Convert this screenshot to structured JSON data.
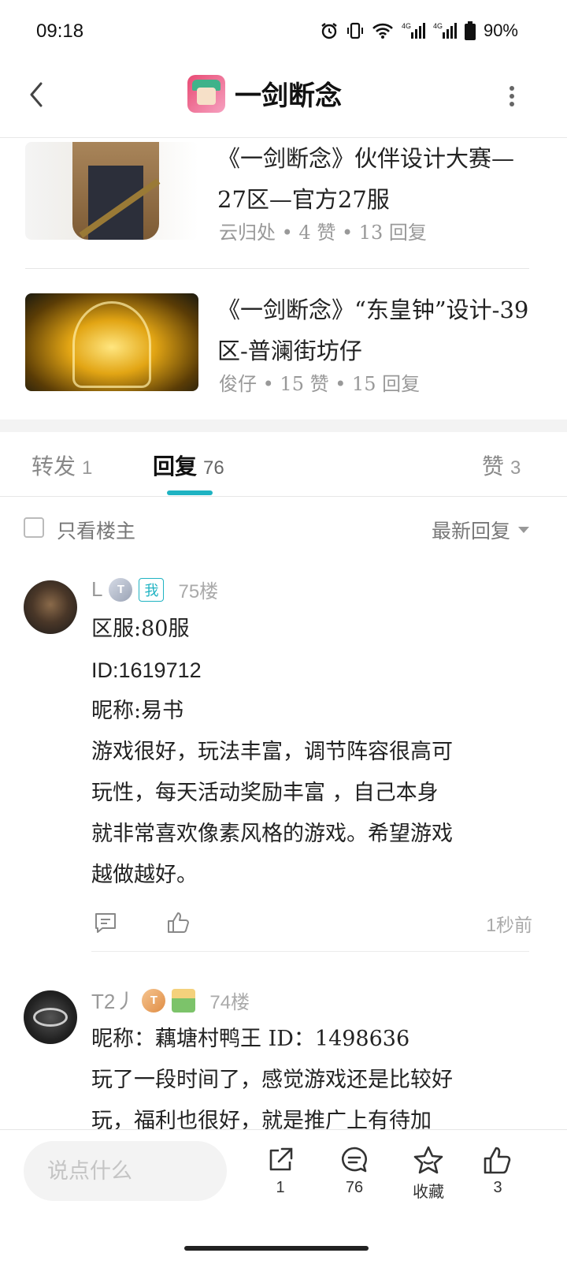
{
  "status": {
    "time": "09:18",
    "battery": "90%"
  },
  "header": {
    "title": "一剑断念"
  },
  "related": [
    {
      "title": "《一剑断念》伙伴设计大赛—27区—官方27服",
      "author": "云归处",
      "likes": "4 赞",
      "replies": "13 回复"
    },
    {
      "title": "《一剑断念》“东皇钟”设计-39区-普澜街坊仔",
      "author": "俊仔",
      "likes": "15 赞",
      "replies": "15 回复"
    }
  ],
  "tabs": [
    {
      "label": "转发",
      "count": "1"
    },
    {
      "label": "回复",
      "count": "76"
    },
    {
      "label": "赞",
      "count": "3"
    }
  ],
  "filter": {
    "only_op": "只看楼主",
    "sort": "最新回复"
  },
  "replies": [
    {
      "user": "L",
      "level": "T",
      "me_tag": "我",
      "floor": "75楼",
      "lines": [
        "区服:80服",
        "ID:1619712",
        "昵称:易书",
        "游戏很好，玩法丰富，调节阵容很高可",
        "玩性，每天活动奖励丰富 ，自己本身",
        "就非常喜欢像素风格的游戏。希望游戏",
        "越做越好。"
      ],
      "time": "1秒前"
    },
    {
      "user": "T2丿",
      "level": "T",
      "floor": "74楼",
      "lines": [
        "昵称：藕塘村鸭王 ID：1498636",
        "玩了一段时间了，感觉游戏还是比较好",
        "玩，福利也很好，就是推广上有待加"
      ]
    }
  ],
  "bottom": {
    "input_placeholder": "说点什么",
    "share_count": "1",
    "comment_count": "76",
    "favorite_label": "收藏",
    "like_count": "3"
  },
  "colors": {
    "accent": "#1fb3c2",
    "muted": "#999999"
  }
}
